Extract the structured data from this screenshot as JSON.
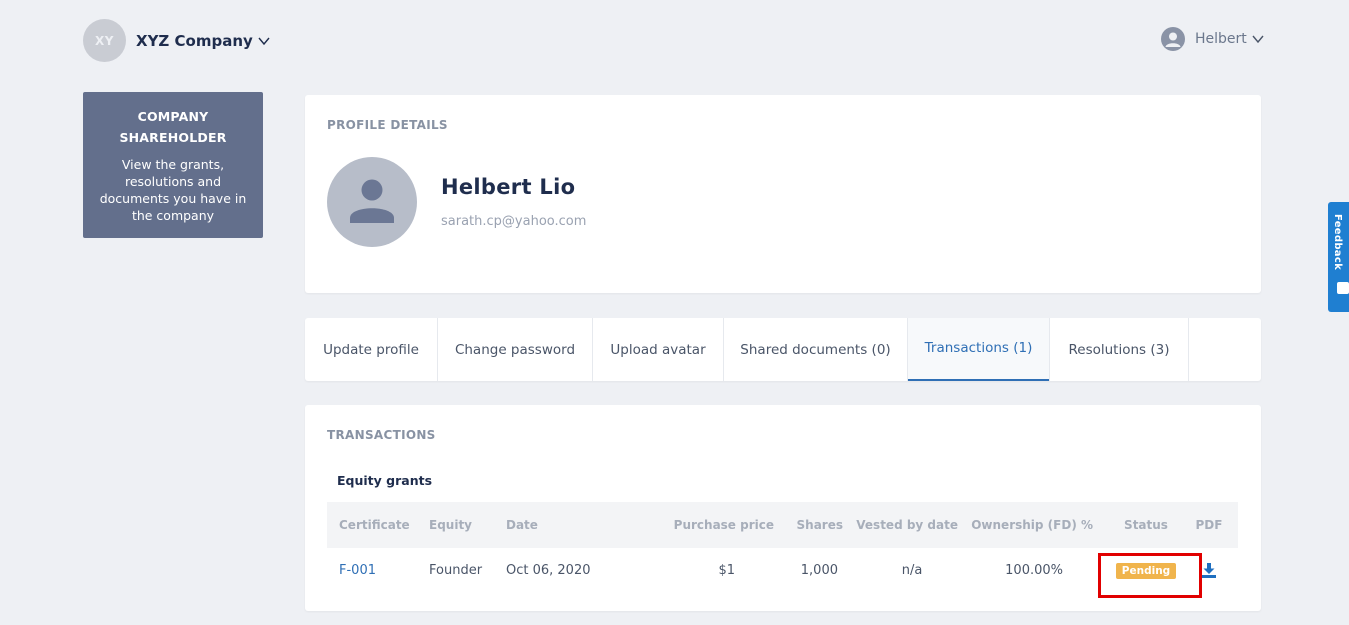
{
  "header": {
    "company_initials": "XY",
    "company_name": "XYZ Company",
    "user_name": "Helbert"
  },
  "sidebar": {
    "title_line1": "COMPANY",
    "title_line2": "SHAREHOLDER",
    "description": "View the grants, resolutions and documents you have in the company"
  },
  "profile": {
    "section_label": "PROFILE DETAILS",
    "name": "Helbert Lio",
    "email": "sarath.cp@yahoo.com"
  },
  "tabs": [
    {
      "label": "Update profile",
      "active": false
    },
    {
      "label": "Change password",
      "active": false
    },
    {
      "label": "Upload avatar",
      "active": false
    },
    {
      "label": "Shared documents (0)",
      "active": false
    },
    {
      "label": "Transactions (1)",
      "active": true
    },
    {
      "label": "Resolutions (3)",
      "active": false
    }
  ],
  "transactions": {
    "section_label": "TRANSACTIONS",
    "subsection_label": "Equity grants",
    "columns": {
      "certificate": "Certificate",
      "equity": "Equity",
      "date": "Date",
      "purchase_price": "Purchase price",
      "shares": "Shares",
      "vested_by_date": "Vested by date",
      "ownership": "Ownership (FD) %",
      "status": "Status",
      "pdf": "PDF"
    },
    "rows": [
      {
        "certificate": "F-001",
        "equity": "Founder",
        "date": "Oct 06, 2020",
        "purchase_price": "$1",
        "shares": "1,000",
        "vested_by_date": "n/a",
        "ownership": "100.00%",
        "status": "Pending"
      }
    ]
  },
  "feedback": {
    "label": "Feedback"
  },
  "colors": {
    "accent": "#2f6fb5",
    "sidebar_bg": "#636f8c",
    "pending_badge": "#f0b44c",
    "highlight": "#e10000",
    "feedback_tab": "#1f7fd1"
  }
}
